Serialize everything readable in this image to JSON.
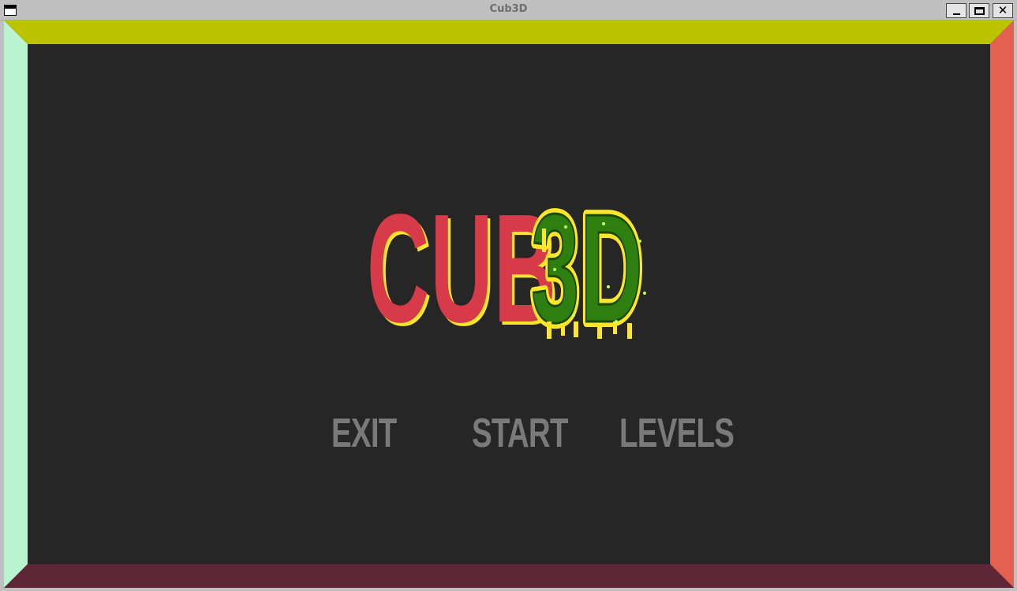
{
  "window": {
    "title": "Cub3D"
  },
  "titlebar_icons": {
    "menu": "window-menu-icon",
    "minimize": "minimize-icon",
    "maximize": "maximize-icon",
    "close": "close-icon",
    "close_glyph": "✕"
  },
  "game": {
    "logo": {
      "text_part1": "CUB",
      "text_part2": "3D"
    },
    "menu": {
      "exit": "EXIT",
      "start": "START",
      "levels": "LEVELS"
    }
  },
  "colors": {
    "ceiling_wall": "#bcc300",
    "left_wall": "#b8f4d0",
    "right_wall": "#e46050",
    "floor_wall": "#5e2636",
    "background": "#262626",
    "logo_red": "#d73a48",
    "logo_yellow": "#ffe62a",
    "logo_green": "#2f7e10",
    "menu_text": "#7a7a7a"
  }
}
